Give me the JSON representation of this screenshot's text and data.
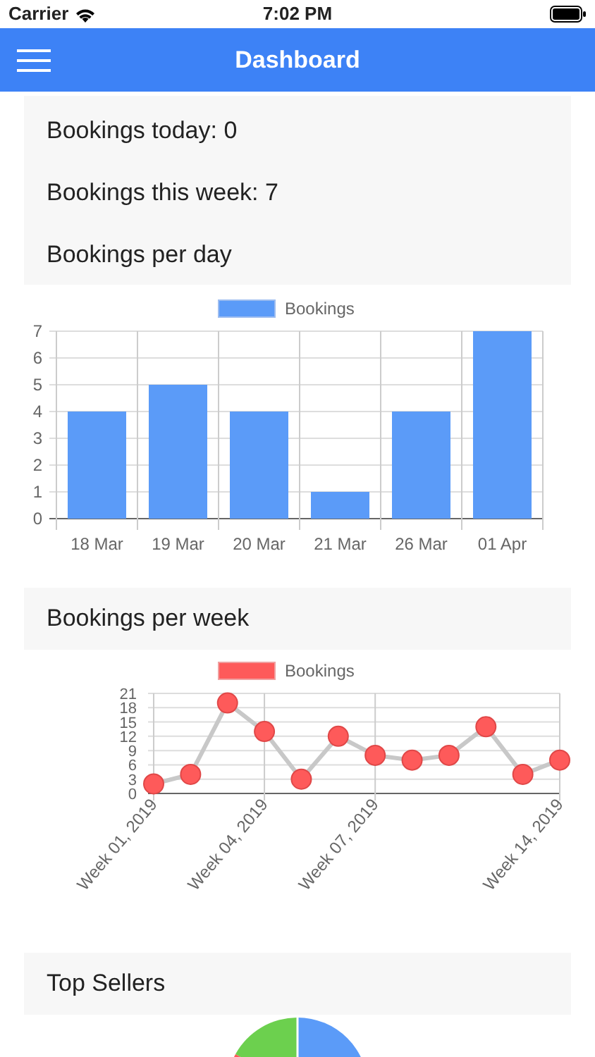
{
  "status_bar": {
    "carrier": "Carrier",
    "time": "7:02 PM"
  },
  "header": {
    "title": "Dashboard"
  },
  "summary": [
    {
      "text": "Bookings today: 0"
    },
    {
      "text": "Bookings this week: 7"
    },
    {
      "text": "Bookings per day"
    }
  ],
  "daily_chart": {
    "chart_data": {
      "type": "bar",
      "categories": [
        "18 Mar",
        "19 Mar",
        "20 Mar",
        "21 Mar",
        "26 Mar",
        "01 Apr"
      ],
      "series": [
        {
          "name": "Bookings",
          "color": "#5b9bf8",
          "values": [
            4,
            5,
            4,
            1,
            4,
            7
          ]
        }
      ],
      "ylim": [
        0,
        7
      ],
      "yticks": [
        0,
        1,
        2,
        3,
        4,
        5,
        6,
        7
      ],
      "grid": true
    }
  },
  "weekly_title": "Bookings per week",
  "weekly_chart": {
    "chart_data": {
      "type": "line",
      "categories": [
        "Week 01, 2019",
        null,
        null,
        "Week 04, 2019",
        null,
        null,
        "Week 07, 2019",
        null,
        null,
        null,
        null,
        "Week 14, 2019"
      ],
      "series": [
        {
          "name": "Bookings",
          "color": "#fe5a5a",
          "marker": "circle",
          "values": [
            2,
            4,
            19,
            13,
            3,
            12,
            8,
            7,
            8,
            14,
            4,
            7
          ]
        }
      ],
      "ylim": [
        0,
        21
      ],
      "yticks": [
        0,
        3,
        6,
        9,
        12,
        15,
        18,
        21
      ],
      "grid": true
    }
  },
  "top_sellers_title": "Top Sellers"
}
